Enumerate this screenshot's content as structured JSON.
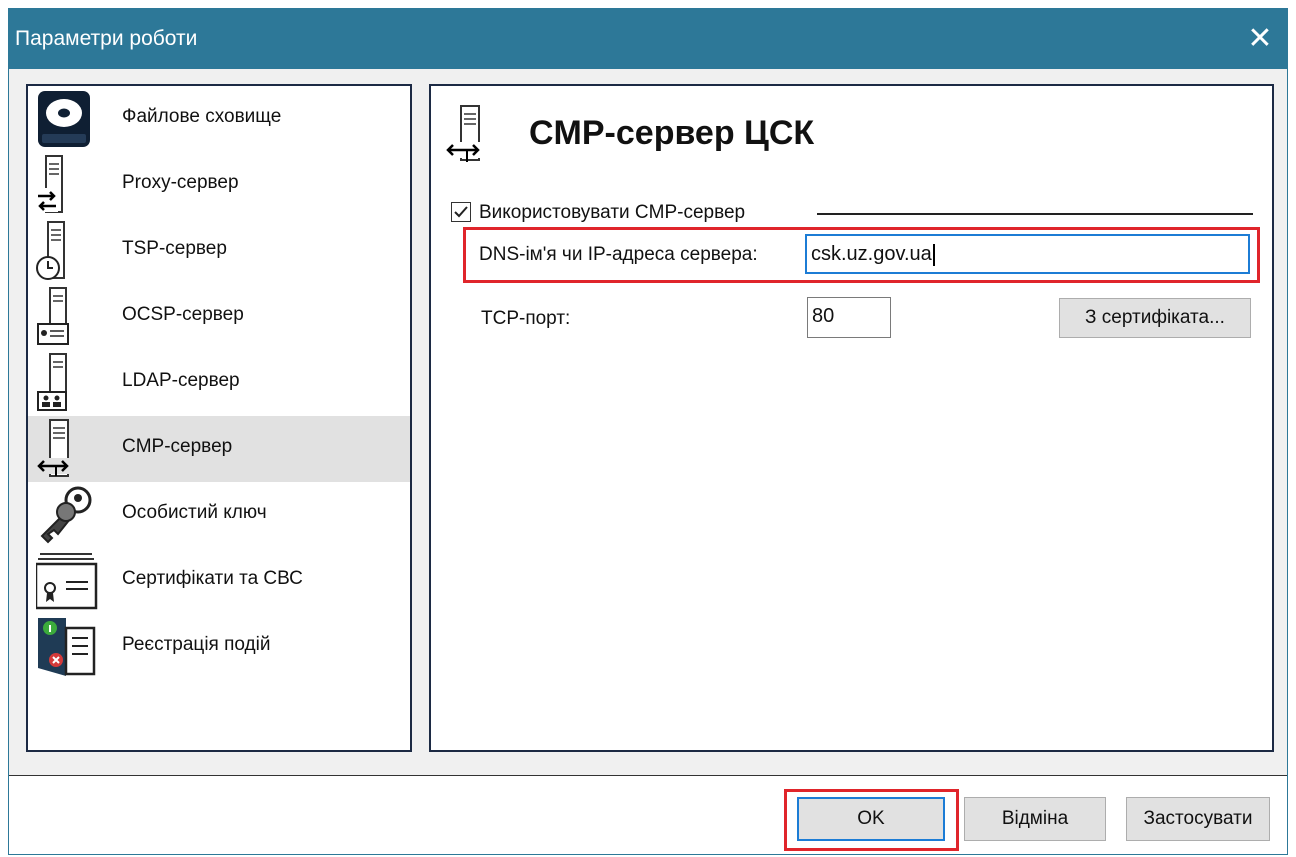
{
  "window": {
    "title": "Параметри роботи",
    "close_glyph": "✕"
  },
  "nav": {
    "selected_index": 5,
    "items": [
      {
        "label": "Файлове сховище",
        "icon": "hard-drive-icon"
      },
      {
        "label": "Proxy-сервер",
        "icon": "proxy-server-icon"
      },
      {
        "label": "TSP-сервер",
        "icon": "tsp-server-icon"
      },
      {
        "label": "OCSP-сервер",
        "icon": "ocsp-server-icon"
      },
      {
        "label": "LDAP-сервер",
        "icon": "ldap-server-icon"
      },
      {
        "label": "CMP-сервер",
        "icon": "cmp-server-icon"
      },
      {
        "label": "Особистий ключ",
        "icon": "key-icon"
      },
      {
        "label": "Сертифікати та СВС",
        "icon": "certificate-icon"
      },
      {
        "label": "Реєстрація подій",
        "icon": "event-log-icon"
      }
    ]
  },
  "panel": {
    "heading": "CMP-сервер ЦСК",
    "use_cmp": {
      "label": "Використовувати CMP-сервер",
      "checked": true
    },
    "dns": {
      "label": "DNS-ім'я чи IP-адреса сервера:",
      "value": "csk.uz.gov.ua"
    },
    "port": {
      "label": "TCP-порт:",
      "value": "80"
    },
    "cert_button": "З сертифіката..."
  },
  "footer": {
    "ok": "OK",
    "cancel": "Відміна",
    "apply": "Застосувати"
  },
  "colors": {
    "titlebar": "#2d7898",
    "highlight": "#e0252b",
    "focus": "#1c7cd5",
    "selected": "#e1e1e1"
  }
}
